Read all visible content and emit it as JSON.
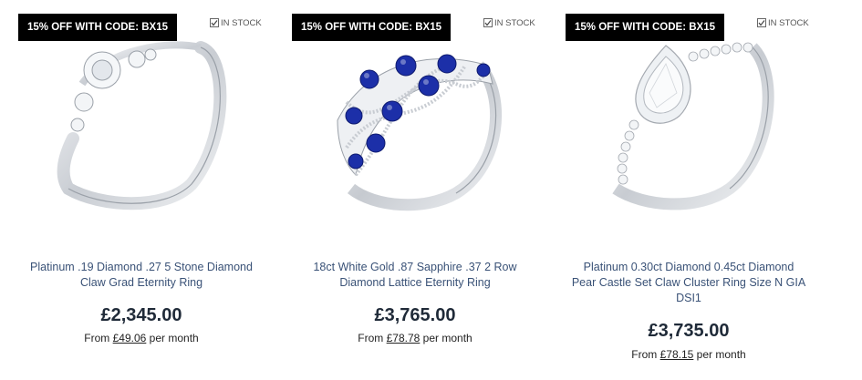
{
  "products": [
    {
      "promo": "15% OFF WITH CODE: BX15",
      "stock": "IN STOCK",
      "title": "Platinum .19 Diamond .27 5 Stone Diamond Claw Grad Eternity Ring",
      "price": "£2,345.00",
      "monthly_prefix": "From",
      "monthly_amount": "£49.06",
      "monthly_suffix": "per month",
      "stone_color": "#f4f6f8"
    },
    {
      "promo": "15% OFF WITH CODE: BX15",
      "stock": "IN STOCK",
      "title": "18ct White Gold .87 Sapphire .37 2 Row Diamond Lattice Eternity Ring",
      "price": "£3,765.00",
      "monthly_prefix": "From",
      "monthly_amount": "£78.78",
      "monthly_suffix": "per month",
      "stone_color": "#1c2fa8"
    },
    {
      "promo": "15% OFF WITH CODE: BX15",
      "stock": "IN STOCK",
      "title": "Platinum 0.30ct Diamond 0.45ct Diamond Pear Castle Set Claw Cluster Ring Size N GIA DSI1",
      "price": "£3,735.00",
      "monthly_prefix": "From",
      "monthly_amount": "£78.15",
      "monthly_suffix": "per month",
      "stone_color": "#f4f6f8"
    }
  ],
  "colors": {
    "promo_bg": "#000000",
    "title": "#3a5277",
    "price": "#1f2a38",
    "metal": "#cfd3d8"
  }
}
